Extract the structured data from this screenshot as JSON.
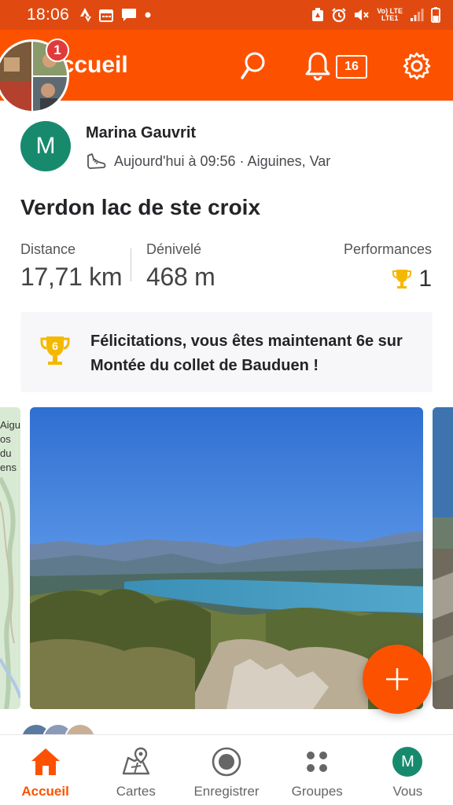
{
  "status_bar": {
    "time": "18:06",
    "lte_top": "Vo) LTE",
    "lte_bottom": "LTE1"
  },
  "header": {
    "title": "Accueil",
    "notification_badge": "1",
    "inbox_count": "16",
    "icons": [
      "search-icon",
      "bell-icon",
      "inbox-icon",
      "gear-icon"
    ]
  },
  "activity": {
    "athlete_initial": "M",
    "athlete_name": "Marina Gauvrit",
    "meta": "Aujourd'hui à 09:56 · Aiguines, Var",
    "title": "Verdon lac de ste croix",
    "stats": {
      "distance_label": "Distance",
      "distance_value": "17,71 km",
      "elevation_label": "Dénivelé",
      "elevation_value": "468 m",
      "performances_label": "Performances",
      "performances_value": "1"
    },
    "achievement": {
      "rank": "6",
      "text": "Félicitations, vous êtes maintenant 6e sur Montée du collet de Bauduen !"
    },
    "map_labels": [
      "Aigu",
      "os du",
      "ens"
    ]
  },
  "colors": {
    "brand": "#fc5200",
    "status_bar": "#e04a10",
    "avatar_green": "#178a6e",
    "trophy_gold": "#f5b800"
  },
  "bottom_nav": {
    "items": [
      {
        "label": "Accueil",
        "icon": "home-icon",
        "active": true
      },
      {
        "label": "Cartes",
        "icon": "map-icon",
        "active": false
      },
      {
        "label": "Enregistrer",
        "icon": "record-icon",
        "active": false
      },
      {
        "label": "Groupes",
        "icon": "groups-icon",
        "active": false
      },
      {
        "label": "Vous",
        "icon": "profile-avatar",
        "active": false
      }
    ],
    "profile_initial": "M"
  }
}
